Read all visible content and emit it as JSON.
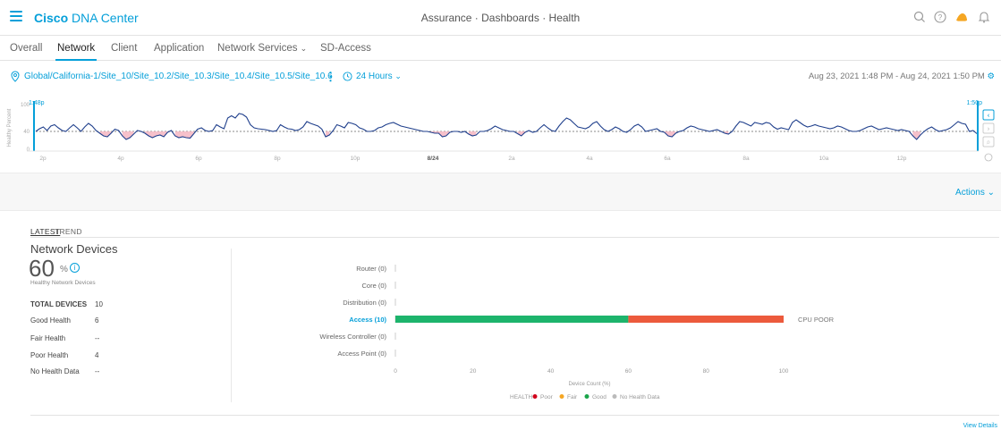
{
  "header": {
    "brand_bold": "Cisco",
    "brand_rest": " DNA Center",
    "breadcrumb": [
      "Assurance",
      "Dashboards",
      "Health"
    ],
    "breadcrumb_sep": " · ",
    "icons": [
      "search-icon",
      "help-icon",
      "alert-icon",
      "bell-icon"
    ]
  },
  "tabs": [
    {
      "label": "Overall",
      "active": false
    },
    {
      "label": "Network",
      "active": true
    },
    {
      "label": "Client",
      "active": false
    },
    {
      "label": "Application",
      "active": false
    },
    {
      "label": "Network Services",
      "active": false,
      "dropdown": true
    },
    {
      "label": "SD-Access",
      "active": false
    }
  ],
  "location": {
    "path": "Global/California-1/Site_10/Site_10.2/Site_10.3/Site_10.4/Site_10.5/Site_10.6",
    "time_window": "24 Hours",
    "range": "Aug 23, 2021 1:48 PM - Aug 24, 2021 1:50 PM"
  },
  "timeline": {
    "ylabel": "Healthy Percent",
    "yticks": [
      "100",
      "40",
      "0"
    ],
    "xticks": [
      "2p",
      "4p",
      "6p",
      "8p",
      "10p",
      "8/24",
      "2a",
      "4a",
      "6a",
      "8a",
      "10a",
      "12p"
    ],
    "start_label": "1:48p",
    "end_label": "1:50p",
    "threshold": 40,
    "series": [
      40,
      46,
      50,
      42,
      52,
      55,
      48,
      42,
      40,
      48,
      55,
      48,
      40,
      50,
      58,
      52,
      42,
      36,
      30,
      28,
      36,
      45,
      42,
      30,
      22,
      26,
      34,
      42,
      40,
      36,
      30,
      26,
      30,
      32,
      28,
      38,
      42,
      30,
      26,
      28,
      26,
      25,
      35,
      45,
      48,
      42,
      40,
      42,
      55,
      50,
      46,
      70,
      75,
      70,
      80,
      78,
      72,
      55,
      48,
      46,
      45,
      44,
      42,
      40,
      42,
      55,
      50,
      46,
      45,
      42,
      44,
      50,
      62,
      58,
      55,
      52,
      45,
      28,
      32,
      42,
      55,
      52,
      48,
      60,
      58,
      55,
      48,
      45,
      40,
      40,
      42,
      48,
      50,
      55,
      58,
      60,
      56,
      52,
      50,
      48,
      46,
      44,
      42,
      40,
      40,
      38,
      36,
      36,
      28,
      30,
      38,
      40,
      40,
      38,
      40,
      34,
      30,
      32,
      40,
      40,
      42,
      46,
      52,
      48,
      44,
      42,
      40,
      40,
      35,
      30,
      38,
      42,
      38,
      40,
      48,
      55,
      48,
      42,
      40,
      52,
      62,
      70,
      66,
      58,
      50,
      48,
      46,
      50,
      58,
      62,
      52,
      44,
      40,
      44,
      50,
      46,
      40,
      38,
      44,
      52,
      56,
      50,
      40,
      42,
      44,
      46,
      40,
      38,
      30,
      28,
      36,
      40,
      42,
      48,
      52,
      50,
      46,
      44,
      42,
      40,
      42,
      44,
      40,
      36,
      34,
      40,
      52,
      62,
      60,
      56,
      52,
      60,
      58,
      56,
      60,
      58,
      50,
      45,
      48,
      46,
      44,
      60,
      66,
      60,
      54,
      50,
      52,
      55,
      52,
      50,
      48,
      46,
      48,
      52,
      50,
      46,
      42,
      40,
      40,
      42,
      46,
      50,
      52,
      48,
      44,
      46,
      48,
      46,
      44,
      42,
      44,
      42,
      40,
      30,
      22,
      32,
      40,
      46,
      50,
      44,
      40,
      42,
      44,
      48,
      55,
      62,
      58,
      56,
      40,
      42,
      35
    ]
  },
  "actions_label": "Actions",
  "subtabs": [
    "LATEST",
    "TREND"
  ],
  "network_devices": {
    "title": "Network Devices",
    "value": "60",
    "unit": "%",
    "subtitle": "Healthy Network Devices",
    "stats": [
      {
        "label": "TOTAL DEVICES",
        "value": "10",
        "bold": true
      },
      {
        "label": "Good Health",
        "value": "6"
      },
      {
        "label": "Fair Health",
        "value": "--"
      },
      {
        "label": "Poor Health",
        "value": "4"
      },
      {
        "label": "No Health Data",
        "value": "--"
      }
    ]
  },
  "chart_data": {
    "type": "bar",
    "orientation": "horizontal",
    "stacked": true,
    "categories": [
      "Router (0)",
      "Core (0)",
      "Distribution (0)",
      "Access (10)",
      "Wireless Controller (0)",
      "Access Point (0)"
    ],
    "highlighted_category": "Access (10)",
    "series": [
      {
        "name": "Good",
        "values": [
          0,
          0,
          0,
          60,
          0,
          0
        ]
      },
      {
        "name": "Poor",
        "values": [
          0,
          0,
          0,
          40,
          0,
          0
        ]
      }
    ],
    "annotations": [
      {
        "category": "Access (10)",
        "text": "CPU POOR"
      }
    ],
    "xlabel": "Device Count (%)",
    "xlim": [
      0,
      100
    ],
    "xticks": [
      0,
      20,
      40,
      60,
      80,
      100
    ],
    "legend_title": "HEALTH",
    "legend": [
      {
        "name": "Poor",
        "color": "#d0021b"
      },
      {
        "name": "Fair",
        "color": "#f5a623"
      },
      {
        "name": "Good",
        "color": "#1aa54a"
      },
      {
        "name": "No Health Data",
        "color": "#bbbbbb"
      }
    ],
    "legend_position": "bottom"
  },
  "colors": {
    "accent": "#049fd9",
    "good": "#1db46c",
    "poor": "#ec5a3c",
    "line": "#1f3f8c",
    "poor_fill": "#f4b6c2"
  },
  "view_details_label": "View Details"
}
